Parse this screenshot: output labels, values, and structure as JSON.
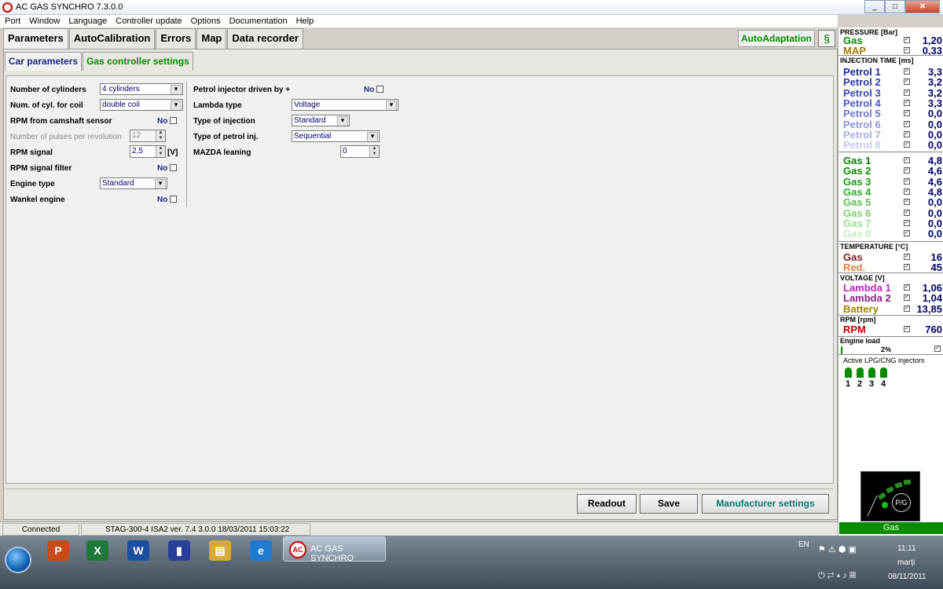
{
  "window": {
    "title": "AC GAS SYNCHRO  7.3.0.0",
    "min": "_",
    "max": "□",
    "close": "✕"
  },
  "menu": [
    "Port",
    "Window",
    "Language",
    "Controller update",
    "Options",
    "Documentation",
    "Help"
  ],
  "main_tabs": [
    "Parameters",
    "AutoCalibration",
    "Errors",
    "Map",
    "Data recorder"
  ],
  "autoadaptation_label": "AutoAdaptation",
  "help_icon": "help-icon",
  "sub_tabs": [
    "Car parameters",
    "Gas controller settings"
  ],
  "left_params": {
    "cylinders_label": "Number of cylinders",
    "cylinders_value": "4 cylinders",
    "coil_label": "Num. of cyl. for coil",
    "coil_value": "double coil",
    "camshaft_label": "RPM from camshaft sensor",
    "camshaft_value": "No",
    "pulses_label": "Number of pulses per revolution",
    "pulses_value": "12",
    "rpm_signal_label": "RPM signal",
    "rpm_signal_value": "2,5",
    "rpm_signal_unit": "[V]",
    "rpm_filter_label": "RPM signal filter",
    "rpm_filter_value": "No",
    "engine_type_label": "Engine type",
    "engine_type_value": "Standard",
    "wankel_label": "Wankel engine",
    "wankel_value": "No"
  },
  "right_params": {
    "petrol_injector_label": "Petrol injector driven by +",
    "petrol_injector_value": "No",
    "lambda_label": "Lambda type",
    "lambda_value": "Voltage",
    "injection_label": "Type of injection",
    "injection_value": "Standard",
    "petrol_inj_label": "Type of petrol inj.",
    "petrol_inj_value": "Sequential",
    "mazda_label": "MAZDA leaning",
    "mazda_value": "0"
  },
  "buttons": {
    "readout": "Readout",
    "save": "Save",
    "manufacturer": "Manufacturer settings"
  },
  "status": {
    "connection": "Connected",
    "device": "STAG-300-4 ISA2  ver. 7.4  3.0.0    18/03/2011 15:03:22"
  },
  "monitor": {
    "pressure_title": "PRESSURE [Bar]",
    "pressure": [
      {
        "name": "Gas",
        "value": "1,20",
        "color": "#0a8a00"
      },
      {
        "name": "MAP",
        "value": "0,33",
        "color": "#a07800"
      }
    ],
    "injection_title": "INJECTION TIME [ms]",
    "petrol": [
      {
        "name": "Petrol 1",
        "value": "3,3",
        "color": "#1a2a9a"
      },
      {
        "name": "Petrol 2",
        "value": "3,2",
        "color": "#2a3aaa"
      },
      {
        "name": "Petrol 3",
        "value": "3,2",
        "color": "#3a4ab8"
      },
      {
        "name": "Petrol 4",
        "value": "3,3",
        "color": "#4a5ac6"
      },
      {
        "name": "Petrol 5",
        "value": "0,0",
        "color": "#6a78d0"
      },
      {
        "name": "Petrol 6",
        "value": "0,0",
        "color": "#8a94da"
      },
      {
        "name": "Petrol 7",
        "value": "0,0",
        "color": "#a8b0e4"
      },
      {
        "name": "Petrol 8",
        "value": "0,0",
        "color": "#c4c8ee"
      }
    ],
    "gas": [
      {
        "name": "Gas 1",
        "value": "4,8",
        "color": "#0a7a00"
      },
      {
        "name": "Gas 2",
        "value": "4,6",
        "color": "#0a8a00"
      },
      {
        "name": "Gas 3",
        "value": "4,6",
        "color": "#1a9a10"
      },
      {
        "name": "Gas 4",
        "value": "4,8",
        "color": "#2aaa20"
      },
      {
        "name": "Gas 5",
        "value": "0,0",
        "color": "#5ac050"
      },
      {
        "name": "Gas 6",
        "value": "0,0",
        "color": "#7ad070"
      },
      {
        "name": "Gas 7",
        "value": "0,0",
        "color": "#9ede96"
      },
      {
        "name": "Gas 8",
        "value": "0,0",
        "color": "#c2ecbe"
      }
    ],
    "temperature_title": "TEMPERATURE [°C]",
    "temperature": [
      {
        "name": "Gas",
        "value": "16",
        "color": "#7a1a1a"
      },
      {
        "name": "Red.",
        "value": "45",
        "color": "#e08040"
      }
    ],
    "voltage_title": "VOLTAGE [V]",
    "voltage": [
      {
        "name": "Lambda 1",
        "value": "1,06",
        "color": "#c020c0"
      },
      {
        "name": "Lambda 2",
        "value": "1,04",
        "color": "#8a1a8a"
      },
      {
        "name": "Battery",
        "value": "13,85",
        "color": "#a08000"
      }
    ],
    "rpm_title": "RPM [rpm]",
    "rpm": [
      {
        "name": "RPM",
        "value": "760",
        "color": "#c00000"
      }
    ],
    "engine_load_title": "Engine load",
    "engine_load_value": "2%",
    "injectors_title": "Active LPG/CNG injectors",
    "injectors": [
      "1",
      "2",
      "3",
      "4"
    ],
    "check_mark": "✓",
    "pg_label": "P/G",
    "mode": "Gas"
  },
  "taskbar": {
    "active_app": "AC GAS SYNCHRO",
    "apps": [
      {
        "glyph": "P",
        "color": "#c84b1c"
      },
      {
        "glyph": "X",
        "color": "#1e7a3a"
      },
      {
        "glyph": "W",
        "color": "#1d4fa0"
      },
      {
        "glyph": "▮",
        "color": "#2a3f9a"
      },
      {
        "glyph": "▤",
        "color": "#d8a838"
      },
      {
        "glyph": "e",
        "color": "#1f7ad0"
      }
    ],
    "lang": "EN",
    "time": "11:11",
    "day": "marți",
    "date": "08/11/2011"
  }
}
